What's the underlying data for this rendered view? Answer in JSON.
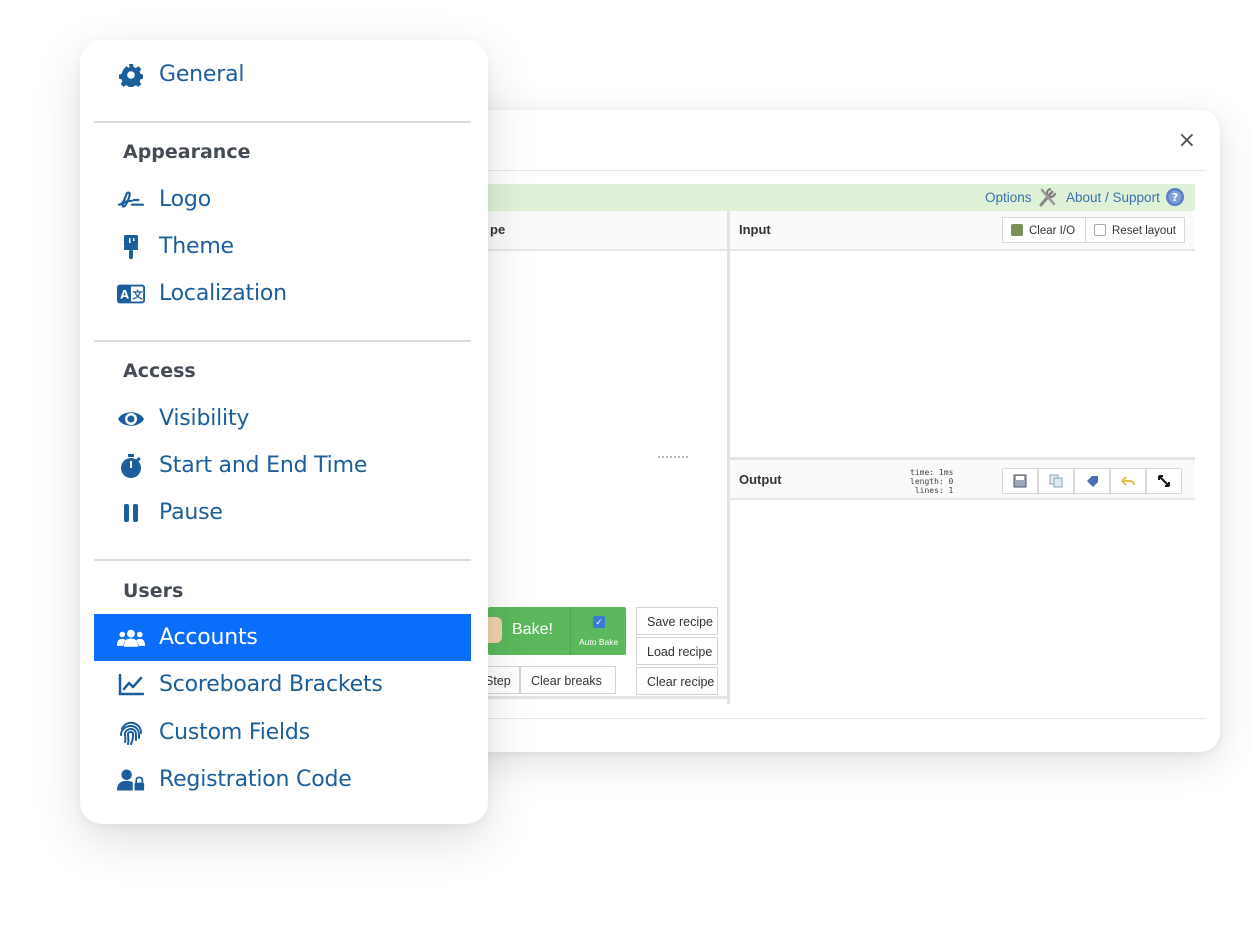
{
  "menu": {
    "colors": {
      "link": "#1c5e9c",
      "active_bg": "#0a6efa",
      "active_text": "#ffffff",
      "section": "#444b55"
    },
    "general": {
      "label": "General",
      "icon": "gear-icon"
    },
    "sections": [
      {
        "title": "Appearance",
        "items": [
          {
            "label": "Logo",
            "icon": "signature-icon"
          },
          {
            "label": "Theme",
            "icon": "paint-brush-icon"
          },
          {
            "label": "Localization",
            "icon": "language-icon"
          }
        ]
      },
      {
        "title": "Access",
        "items": [
          {
            "label": "Visibility",
            "icon": "eye-icon"
          },
          {
            "label": "Start and End Time",
            "icon": "stopwatch-icon"
          },
          {
            "label": "Pause",
            "icon": "pause-icon"
          }
        ]
      },
      {
        "title": "Users",
        "items": [
          {
            "label": "Accounts",
            "icon": "users-icon",
            "active": true
          },
          {
            "label": "Scoreboard Brackets",
            "icon": "chart-line-icon"
          },
          {
            "label": "Custom Fields",
            "icon": "fingerprint-icon"
          },
          {
            "label": "Registration Code",
            "icon": "user-lock-icon"
          }
        ]
      }
    ]
  },
  "modal": {
    "close": "×",
    "banner": {
      "options": "Options",
      "about": "About / Support",
      "bg": "#dff2d8"
    },
    "recipe": {
      "title_fragment": "pe",
      "bake_label": "Bake!",
      "auto_bake_label": "Auto Bake",
      "save_recipe": "Save recipe",
      "load_recipe": "Load recipe",
      "clear_recipe": "Clear recipe",
      "step": "Step",
      "clear_breaks": "Clear breaks",
      "bake_color": "#5cb85c"
    },
    "input": {
      "title": "Input",
      "clear_io": "Clear I/O",
      "reset_layout": "Reset layout"
    },
    "output": {
      "title": "Output",
      "stats": {
        "time": "time:  1ms",
        "length": "length:    0",
        "lines": "lines:    1"
      }
    }
  }
}
